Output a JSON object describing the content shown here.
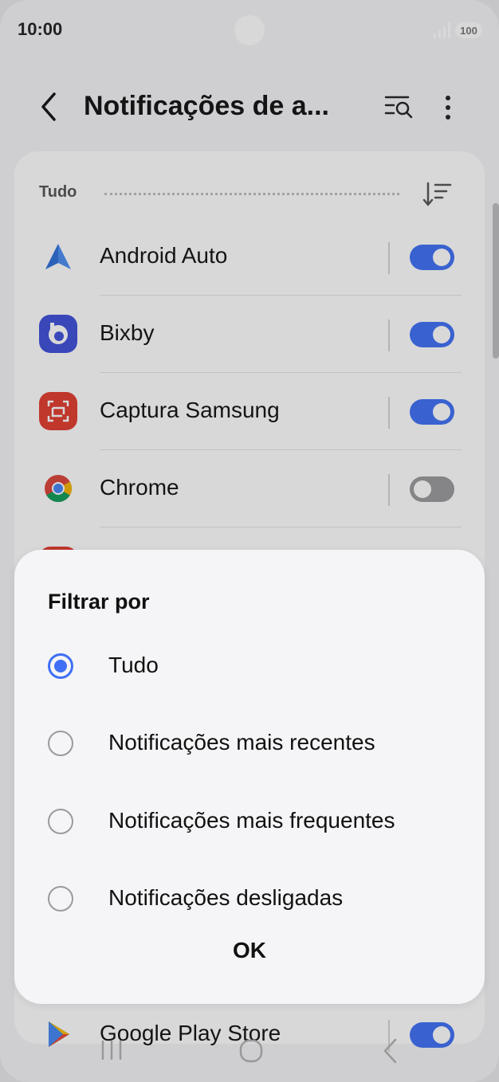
{
  "status": {
    "time": "10:00",
    "battery": "100"
  },
  "header": {
    "title": "Notificações de a..."
  },
  "filter": {
    "label": "Tudo"
  },
  "apps": [
    {
      "name": "Android Auto",
      "enabled": true
    },
    {
      "name": "Bixby",
      "enabled": true
    },
    {
      "name": "Captura Samsung",
      "enabled": true
    },
    {
      "name": "Chrome",
      "enabled": false
    },
    {
      "name": "Google Play Store",
      "enabled": true
    }
  ],
  "sheet": {
    "title": "Filtrar por",
    "options": [
      {
        "label": "Tudo",
        "selected": true
      },
      {
        "label": "Notificações mais recentes",
        "selected": false
      },
      {
        "label": "Notificações mais frequentes",
        "selected": false
      },
      {
        "label": "Notificações desligadas",
        "selected": false
      }
    ],
    "ok_label": "OK"
  },
  "colors": {
    "accent": "#3e6ff4",
    "scrim": "#28282c"
  }
}
